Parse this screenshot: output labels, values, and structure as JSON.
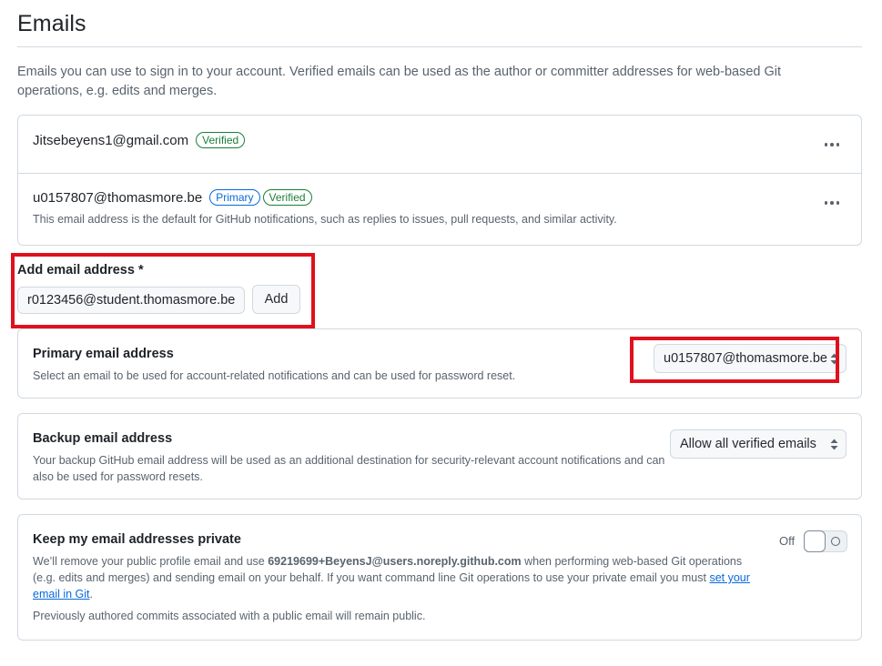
{
  "page": {
    "title": "Emails",
    "intro": "Emails you can use to sign in to your account. Verified emails can be used as the author or committer addresses for web-based Git operations, e.g. edits and merges."
  },
  "emails": [
    {
      "address": "Jitsebeyens1@gmail.com",
      "badges": [
        "Verified"
      ]
    },
    {
      "address": "u0157807@thomasmore.be",
      "badges": [
        "Primary",
        "Verified"
      ],
      "note": "This email address is the default for GitHub notifications, such as replies to issues, pull requests, and similar activity."
    }
  ],
  "add_email": {
    "label": "Add email address *",
    "value": "r0123456@student.thomasmore.be",
    "button": "Add"
  },
  "primary_email": {
    "title": "Primary email address",
    "description": "Select an email to be used for account-related notifications and can be used for password reset.",
    "selected": "u0157807@thomasmore.be"
  },
  "backup_email": {
    "title": "Backup email address",
    "description": "Your backup GitHub email address will be used as an additional destination for security-relevant account notifications and can also be used for password resets.",
    "selected": "Allow all verified emails"
  },
  "private_email": {
    "title": "Keep my email addresses private",
    "desc_part1": "We’ll remove your public profile email and use ",
    "noreply_address": "69219699+BeyensJ@users.noreply.github.com",
    "desc_part2": " when performing web-based Git operations (e.g. edits and merges) and sending email on your behalf. If you want command line Git operations to use your private email you must ",
    "link_text": "set your email in Git",
    "desc_part3": ".",
    "footer": "Previously authored commits associated with a public email will remain public.",
    "toggle_state": "Off"
  },
  "colors": {
    "highlight": "#e0101d",
    "verified": "#1a7f37",
    "primary": "#0969da",
    "link": "#0969da"
  },
  "icons": [
    "kebab-horizontal-icon",
    "select-caret-icon",
    "toggle-off-icon"
  ]
}
